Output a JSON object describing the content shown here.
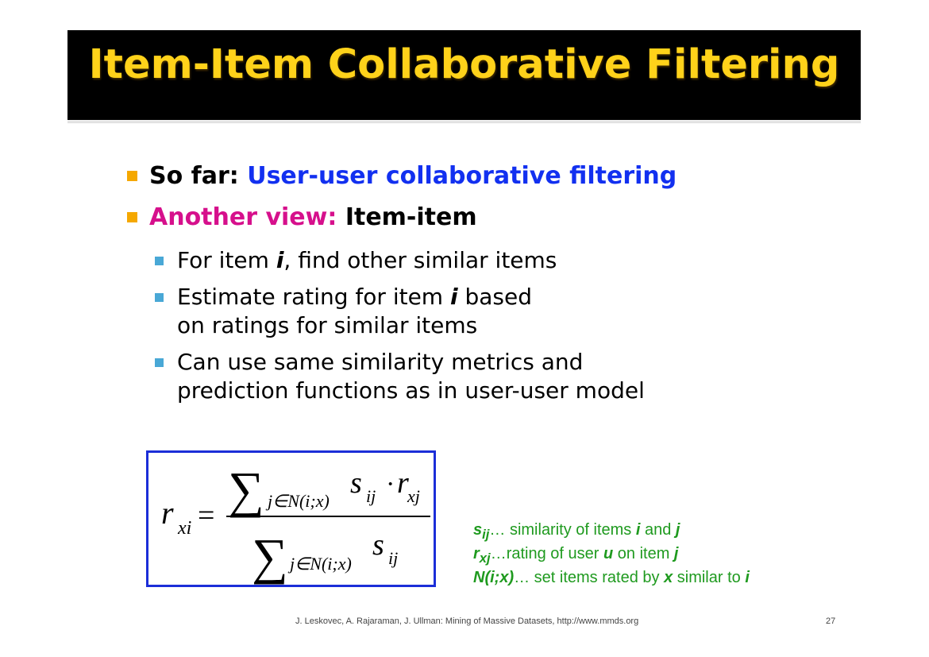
{
  "slide": {
    "title": "Item-Item Collaborative Filtering",
    "bullets": {
      "b1_prefix": "So far: ",
      "b1_highlight": "User-user collaborative filtering",
      "b2_prefix": "Another view: ",
      "b2_rest": "Item-item",
      "sub1_a": "For item ",
      "sub1_i": "i",
      "sub1_b": ", find other similar items",
      "sub2_a": "Estimate rating for item ",
      "sub2_i": "i",
      "sub2_b": " based",
      "sub2_line2": "on ratings for similar items",
      "sub3_line1": "Can use same similarity metrics and",
      "sub3_line2": "prediction functions as in user-user model"
    },
    "formula": {
      "lhs_main": "r",
      "lhs_sub": "xi",
      "equals": "=",
      "sum": "∑",
      "index": "j∈N(i;x)",
      "num_s": "s",
      "num_s_sub": "ij",
      "dot": "·",
      "num_r": "r",
      "num_r_sub": "xj",
      "den_s": "s",
      "den_s_sub": "ij"
    },
    "legend": {
      "l1_var": "s",
      "l1_sub": "ij",
      "l1_text": "… similarity of items ",
      "l1_i": "i",
      "l1_and": " and ",
      "l1_j": "j",
      "l2_var": "r",
      "l2_sub": "xj",
      "l2_text": "…rating of user ",
      "l2_u": "u",
      "l2_on": " on item ",
      "l2_j": "j",
      "l3_var": "N(i;x)",
      "l3_text": "… set items rated by ",
      "l3_x": "x",
      "l3_sim": " similar to ",
      "l3_i": "i"
    },
    "footer": "J. Leskovec, A. Rajaraman, J. Ullman: Mining of Massive Datasets, http://www.mmds.org",
    "page_number": "27",
    "colors": {
      "title": "#ffd21a",
      "title_bg": "#000000",
      "blue": "#1230f0",
      "magenta": "#d6108c",
      "bullet_l1": "#f5a800",
      "bullet_l2": "#49a8d6",
      "formula_border": "#1b2ed8",
      "legend_green": "#1f9a1f"
    }
  }
}
